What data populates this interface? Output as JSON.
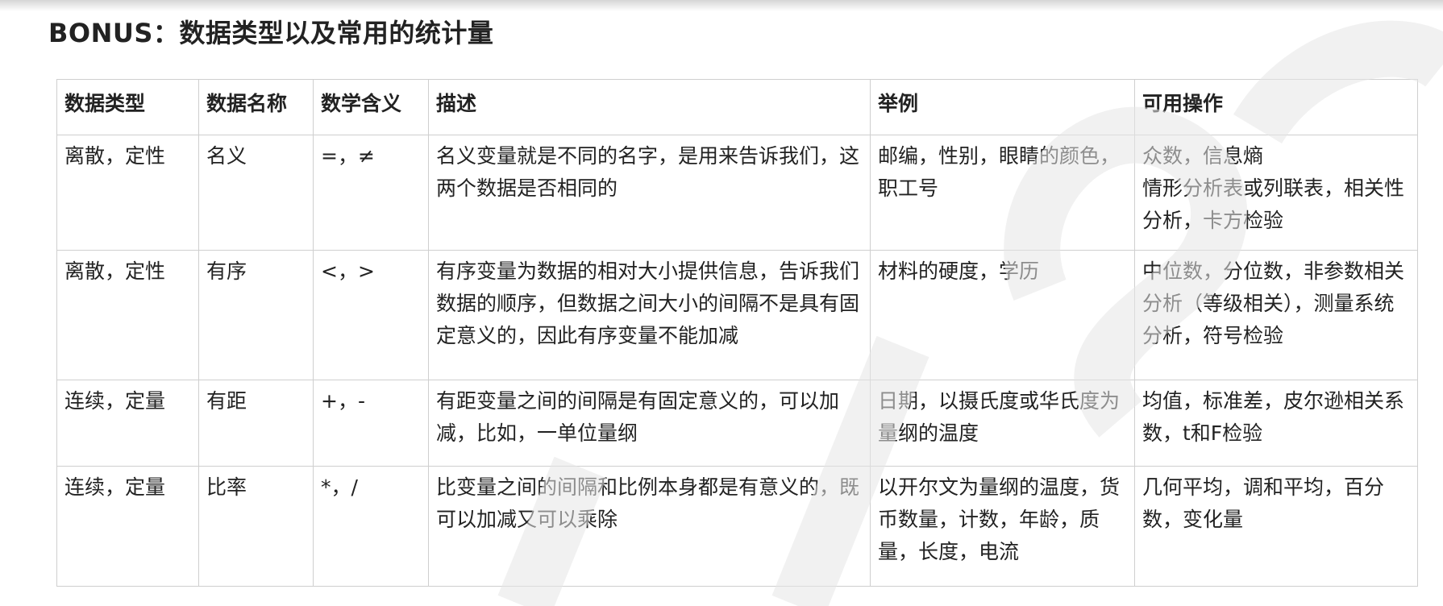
{
  "page": {
    "title": "BONUS：数据类型以及常用的统计量"
  },
  "table": {
    "headers": [
      "数据类型",
      "数据名称",
      "数学含义",
      "描述",
      "举例",
      "可用操作"
    ],
    "rows": [
      {
        "type": "离散，定性",
        "name": "名义",
        "math": "=，≠",
        "description": "名义变量就是不同的名字，是用来告诉我们，这两个数据是否相同的",
        "example": "邮编，性别，眼睛的颜色，职工号",
        "operations": [
          "众数，信息熵",
          "情形分析表或列联表，相关性分析，卡方检验"
        ]
      },
      {
        "type": "离散，定性",
        "name": "有序",
        "math": "<，>",
        "description": "有序变量为数据的相对大小提供信息，告诉我们数据的顺序，但数据之间大小的间隔不是具有固定意义的，因此有序变量不能加减",
        "example": "材料的硬度，学历",
        "operations": [
          "中位数，分位数，非参数相关分析（等级相关），测量系统分析，符号检验"
        ]
      },
      {
        "type": "连续，定量",
        "name": "有距",
        "math": "+，-",
        "description": "有距变量之间的间隔是有固定意义的，可以加减，比如，一单位量纲",
        "example": "日期，以摄氏度或华氏度为量纲的温度",
        "operations": [
          "均值，标准差，皮尔逊相关系数，t和F检验"
        ]
      },
      {
        "type": "连续，定量",
        "name": "比率",
        "math": "*，/",
        "description": "比变量之间的间隔和比例本身都是有意义的，既可以加减又可以乘除",
        "example": "以开尔文为量纲的温度，货币数量，计数，年龄，质量，长度，电流",
        "operations": [
          "几何平均，调和平均，百分数，变化量"
        ]
      }
    ]
  },
  "colors": {
    "watermark": "#e6e6e6",
    "border": "#cfcfcf",
    "text": "#222222"
  }
}
